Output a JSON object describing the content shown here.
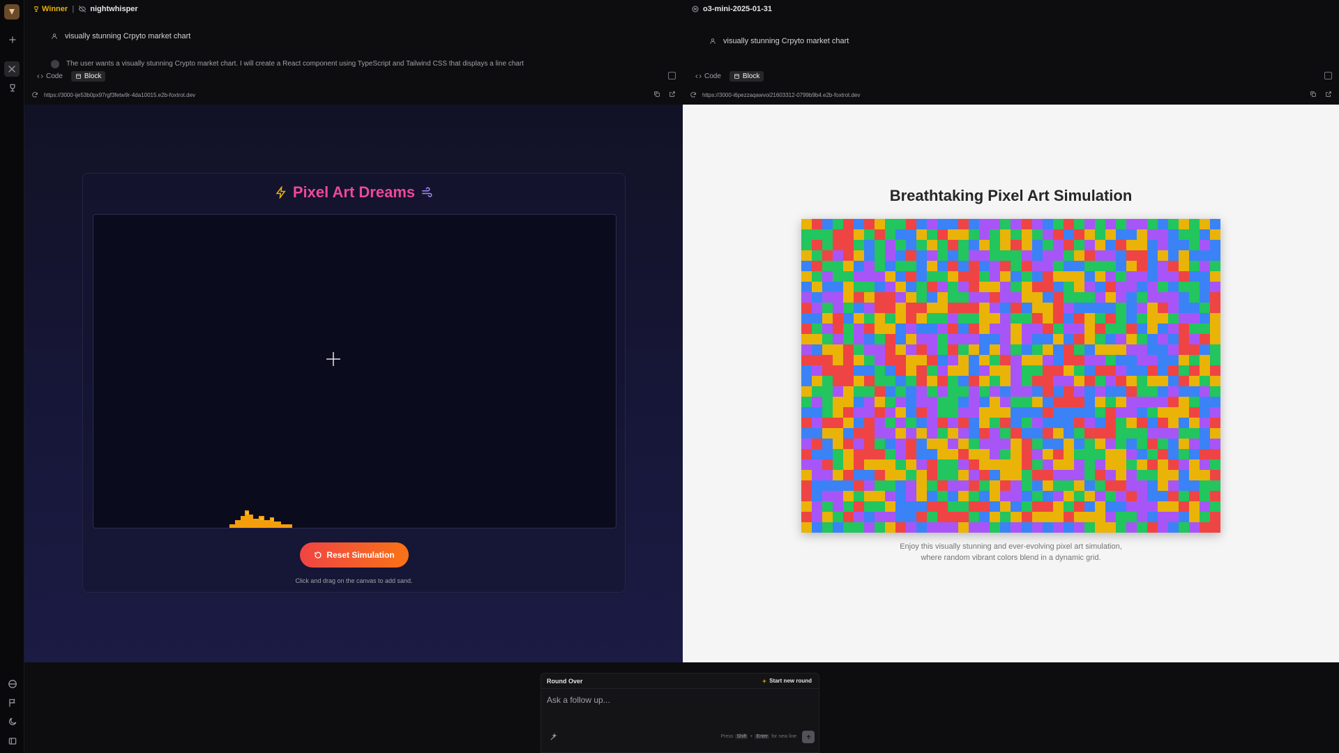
{
  "sidebar": {
    "icons": [
      "app-logo",
      "plus-icon",
      "arena-icon",
      "trophy-icon",
      "globe-icon",
      "flag-icon",
      "moon-icon",
      "sidebar-toggle-icon"
    ]
  },
  "left_panel": {
    "winner_label": "Winner",
    "separator": "|",
    "model_name": "nightwhisper",
    "user_prompt": "visually stunning Crpyto market chart",
    "assistant_preview": "The user wants a visually stunning Crypto market chart. I will create a React component using TypeScript and Tailwind CSS that displays a line chart",
    "tabs": [
      {
        "label": "Code",
        "active": false
      },
      {
        "label": "Block",
        "active": true
      }
    ],
    "url": "https://3000-ije53b0px97rgf3fetw9r-4da10015.e2b-foxtrot.dev",
    "app": {
      "title": "Pixel Art Dreams",
      "title_color": "#ec4899",
      "reset_label": "Reset Simulation",
      "hint": "Click and drag on the canvas to add sand."
    }
  },
  "right_panel": {
    "model_name": "o3-mini-2025-01-31",
    "user_prompt": "visually stunning Crpyto market chart",
    "tabs": [
      {
        "label": "Code",
        "active": false
      },
      {
        "label": "Block",
        "active": true
      }
    ],
    "url": "https://3000-i6pezzaqawvoi21603312-0799b9b4.e2b-foxtrot.dev",
    "app": {
      "title": "Breathtaking Pixel Art Simulation",
      "description": "Enjoy this visually stunning and ever-evolving pixel art simulation, where random vibrant colors blend in a dynamic grid.",
      "grid_colors": [
        "#ef4444",
        "#3b82f6",
        "#22c55e",
        "#eab308",
        "#a855f7"
      ],
      "grid_columns": 40,
      "grid_rows": 30
    }
  },
  "chat": {
    "status": "Round Over",
    "new_round_label": "Start new round",
    "input_placeholder": "Ask a follow up...",
    "key_hint_press": "Press",
    "key_shift": "Shift",
    "key_plus": "+",
    "key_enter": "Enter",
    "key_hint_tail": "for new line"
  }
}
